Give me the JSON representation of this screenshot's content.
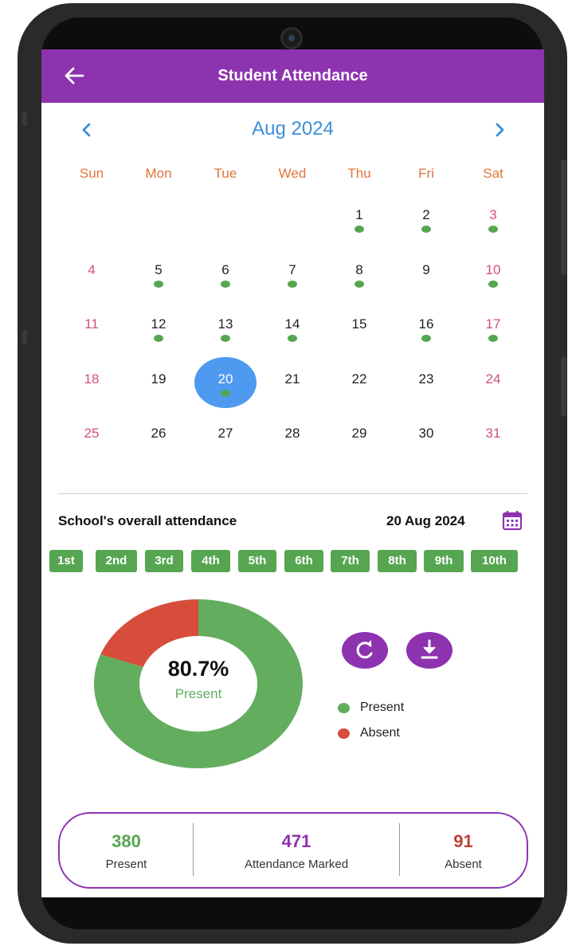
{
  "app_bar": {
    "title": "Student Attendance"
  },
  "calendar": {
    "month_label": "Aug 2024",
    "weekdays": [
      "Sun",
      "Mon",
      "Tue",
      "Wed",
      "Thu",
      "Fri",
      "Sat"
    ],
    "first_weekday_index": 4,
    "days_in_month": 31,
    "selected_day": 20,
    "days_with_attendance": [
      1,
      2,
      3,
      5,
      6,
      7,
      8,
      10,
      12,
      13,
      14,
      16,
      17,
      20
    ],
    "weekend_color": "#d14f7f",
    "dot_color": "#56a651",
    "selected_color": "#4d9af0"
  },
  "overall": {
    "label": "School's overall attendance",
    "date": "20 Aug 2024",
    "classes": [
      "1st",
      "2nd",
      "3rd",
      "4th",
      "5th",
      "6th",
      "7th",
      "8th",
      "9th",
      "10th"
    ]
  },
  "chart_data": {
    "type": "pie",
    "center_value": "80.7%",
    "center_label": "Present",
    "slices": [
      {
        "name": "Present",
        "value": 380,
        "color": "#63ad5e"
      },
      {
        "name": "Absent",
        "value": 91,
        "color": "#d64d3c"
      }
    ]
  },
  "legend": [
    {
      "label": "Present",
      "color": "#63ad5e"
    },
    {
      "label": "Absent",
      "color": "#d64d3c"
    }
  ],
  "actions": {
    "refresh_icon": "refresh-icon",
    "download_icon": "download-icon"
  },
  "summary": {
    "present": {
      "value": "380",
      "label": "Present",
      "color": "#56a651"
    },
    "marked": {
      "value": "471",
      "label": "Attendance Marked",
      "color": "#8e33b0"
    },
    "absent": {
      "value": "91",
      "label": "Absent",
      "color": "#c2413a"
    }
  },
  "colors": {
    "primary": "#8e33b0",
    "accent_blue": "#3c8fd9",
    "weekday": "#e0743a"
  }
}
